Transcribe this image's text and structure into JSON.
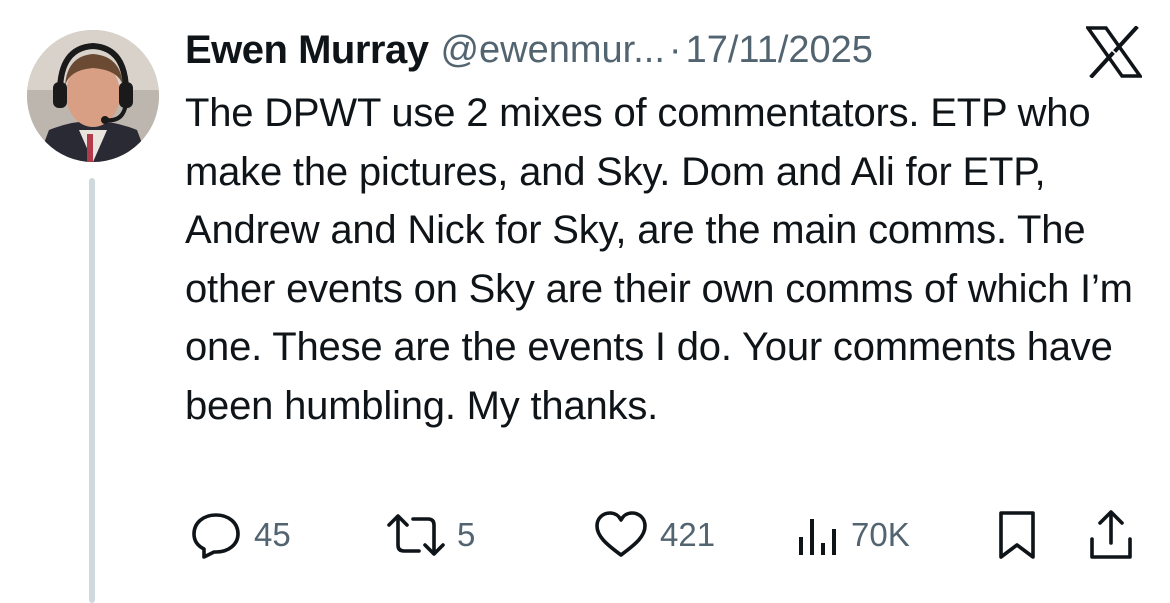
{
  "tweet": {
    "author_name": "Ewen Murray",
    "handle": "@ewenmur...",
    "separator": "·",
    "date": "17/11/2025",
    "text": "The DPWT use 2 mixes of commentators. ETP who make the pictures, and Sky. Dom and Ali for ETP, Andrew and Nick for Sky, are the main comms. The other events on Sky are their own comms of which I’m one. These are the events I do. Your comments have been humbling. My thanks."
  },
  "actions": {
    "replies": "45",
    "reposts": "5",
    "likes": "421",
    "views": "70K"
  },
  "icons": {
    "avatar": "avatar-photo",
    "brand": "x-logo-icon",
    "reply": "reply-icon",
    "repost": "repost-icon",
    "like": "heart-icon",
    "views": "views-icon",
    "bookmark": "bookmark-icon",
    "share": "share-icon"
  },
  "colors": {
    "text": "#0f1419",
    "muted": "#536471",
    "thread_line": "#cfd9de",
    "background": "#ffffff"
  }
}
